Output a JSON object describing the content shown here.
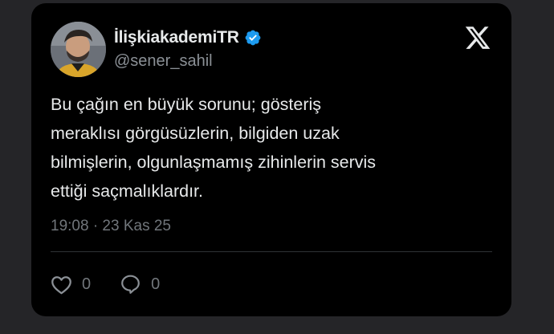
{
  "author": {
    "display_name": "İlişkiakademiTR",
    "handle": "@sener_sahil",
    "verified": true,
    "verified_color": "#1d9bf0"
  },
  "platform": {
    "logo": "x-logo-icon"
  },
  "tweet": {
    "lines": [
      "Bu çağın en büyük sorunu; gösteriş",
      "meraklısı görgüsüzlerin, bilgiden uzak",
      "bilmişlerin, olgunlaşmamış zihinlerin servis",
      "ettiği saçmalıklardır."
    ],
    "timestamp": "19:08 · 23 Kas 25"
  },
  "actions": {
    "likes": {
      "icon": "heart-icon",
      "count": "0"
    },
    "replies": {
      "icon": "reply-bubble-icon",
      "count": "0"
    }
  },
  "colors": {
    "background": "#252528",
    "card": "#000000",
    "text_primary": "#e7e9ea",
    "text_secondary": "#71767b"
  }
}
